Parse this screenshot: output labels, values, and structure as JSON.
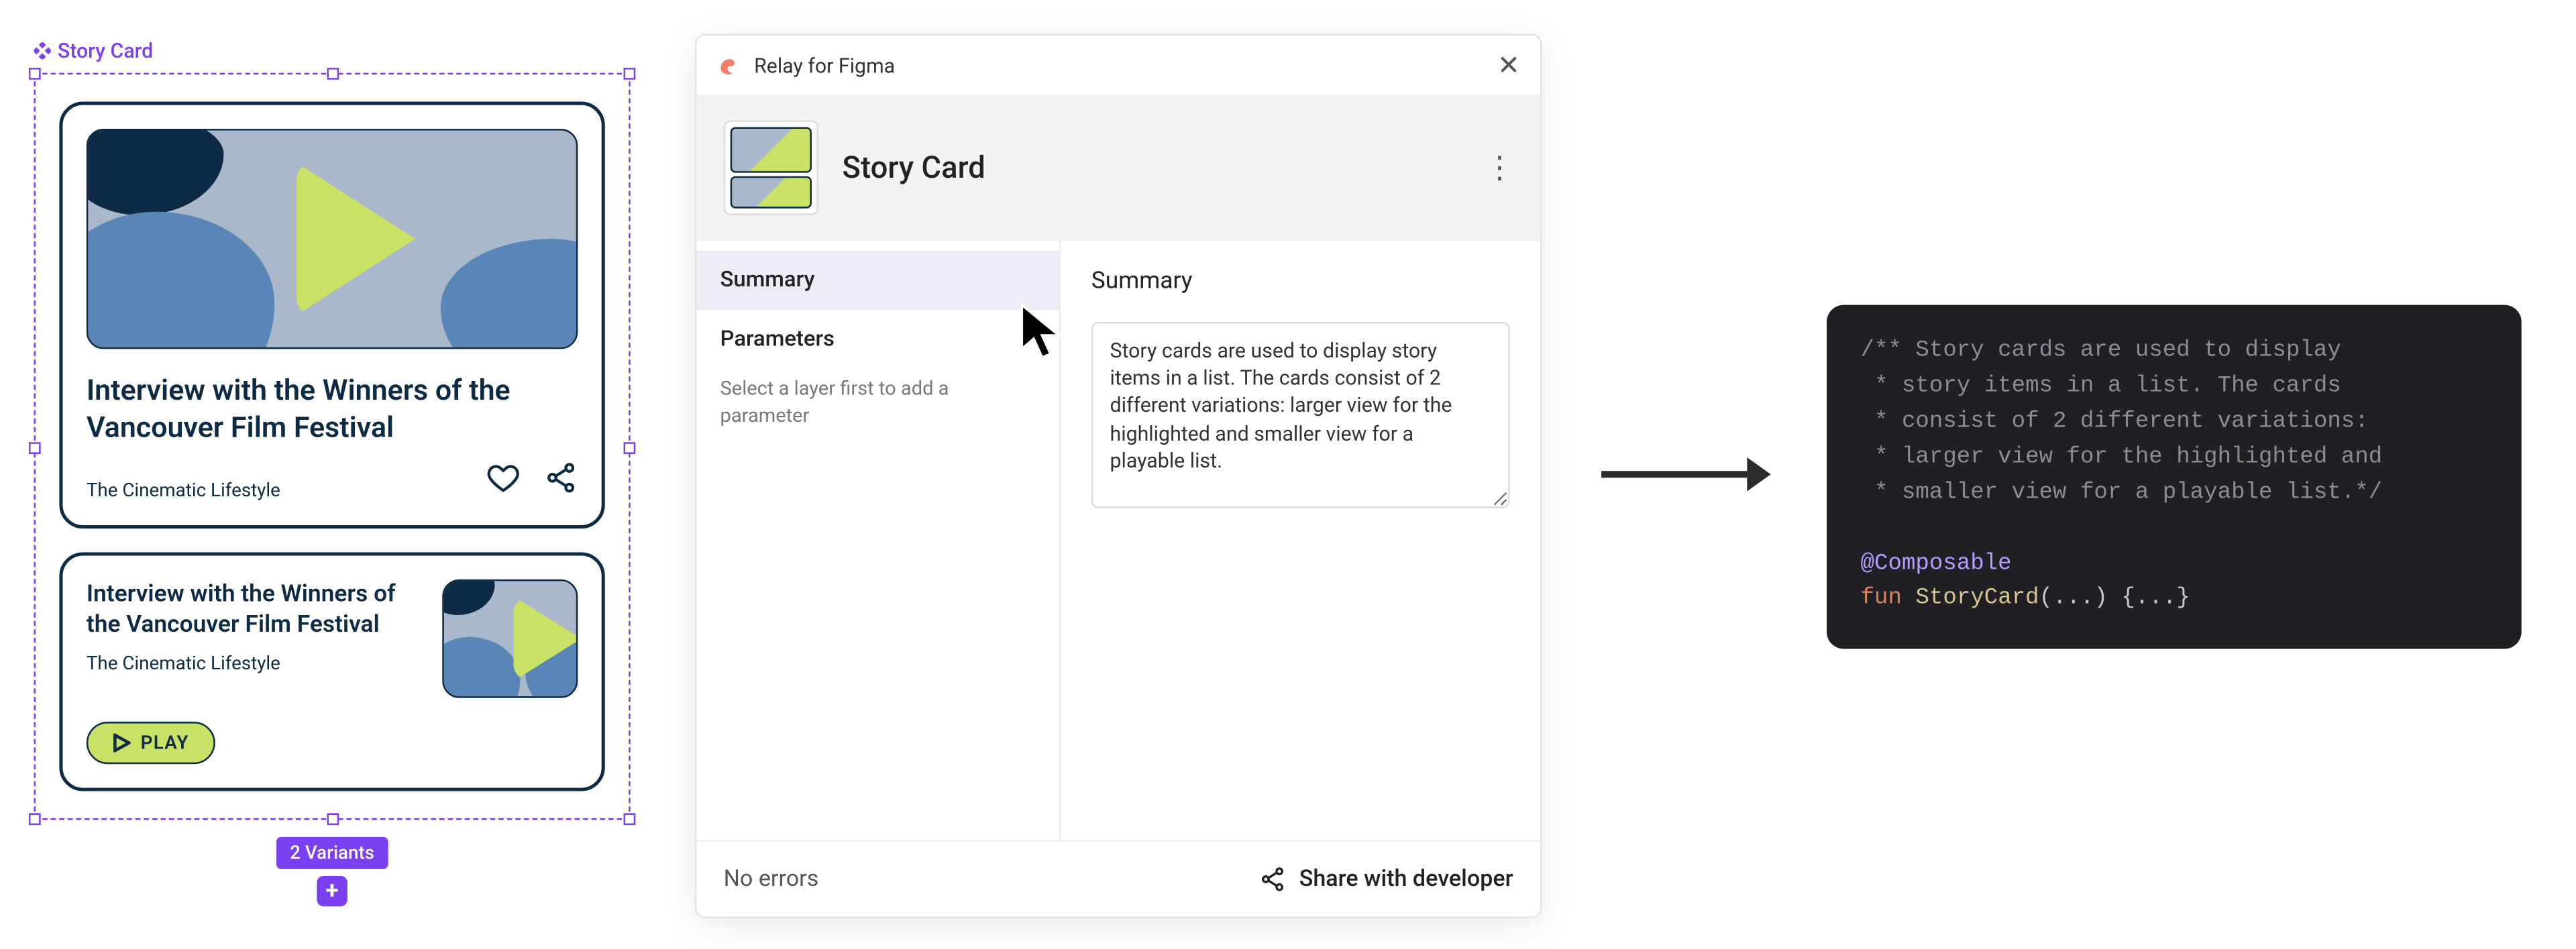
{
  "figma": {
    "component_label": "Story Card",
    "variants_badge": "2 Variants",
    "card_large": {
      "title": "Interview with the Winners of the Vancouver Film Festival",
      "subtitle": "The Cinematic Lifestyle"
    },
    "card_small": {
      "title": "Interview with the Winners of the Vancouver Film Festival",
      "subtitle": "The Cinematic Lifestyle",
      "play_label": "PLAY"
    }
  },
  "plugin": {
    "app_name": "Relay for Figma",
    "title": "Story Card",
    "tabs": {
      "summary": "Summary",
      "parameters": "Parameters",
      "parameters_hint": "Select a layer first to add a parameter"
    },
    "main_heading": "Summary",
    "summary_text": "Story cards are used to display story items in a list. The cards consist of 2 different variations: larger view for the highlighted and smaller view for a playable list.",
    "footer": {
      "status": "No errors",
      "share": "Share with developer"
    }
  },
  "code": {
    "l1": "/** Story cards are used to display",
    "l2": " * story items in a list. The cards",
    "l3": " * consist of 2 different variations:",
    "l4": " * larger view for the highlighted and",
    "l5": " * smaller view for a playable list.*/",
    "anno": "@Composable",
    "kw": "fun",
    "fn": "StoryCard",
    "sig": "(...) {...}"
  }
}
